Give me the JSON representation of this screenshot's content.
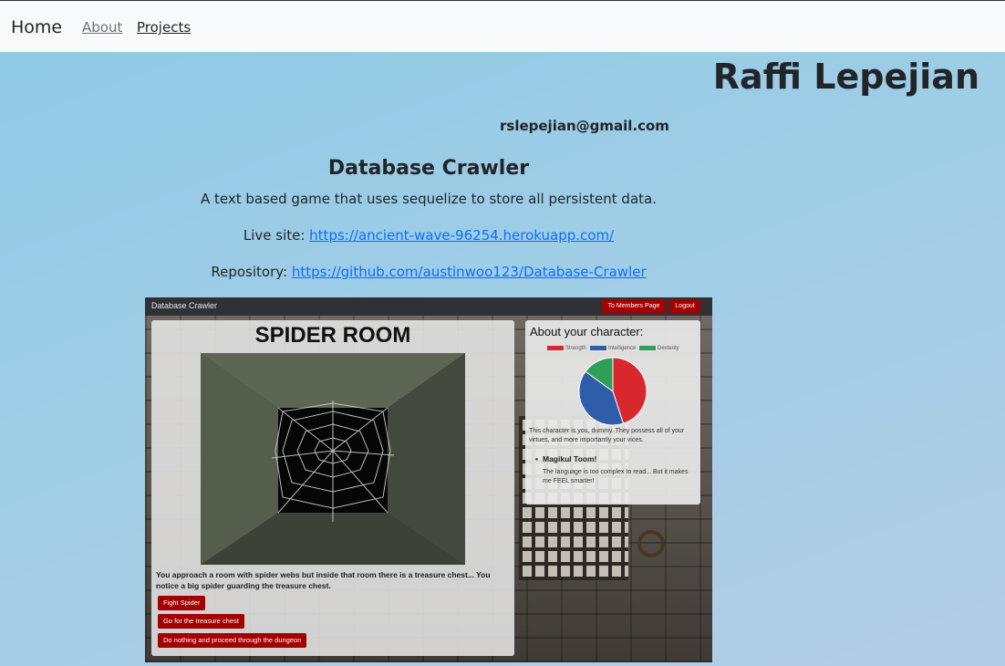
{
  "nav": {
    "brand": "Home",
    "links": [
      "About",
      "Projects"
    ]
  },
  "header": {
    "name": "Raffi Lepejian",
    "email": "rslepejian@gmail.com"
  },
  "project": {
    "title": "Database Crawler",
    "description": "A text based game that uses sequelize to store all persistent data.",
    "live_label": "Live site: ",
    "live_url": "https://ancient-wave-96254.herokuapp.com/",
    "repo_label": "Repository: ",
    "repo_url": "https://github.com/austinwoo123/Database-Crawler"
  },
  "screenshot": {
    "app_title": "Database Crawler",
    "members_button": "To Members Page",
    "logout_button": "Logout",
    "room_title": "SPIDER ROOM",
    "room_description": "You approach a room with spider webs but inside that room there is a treasure chest... You notice a big spider guarding the treasure chest.",
    "actions": [
      "Fight Spider",
      "Go for the treasure chest",
      "Do nothing and proceed through the dungeon"
    ],
    "character_title": "About your character:",
    "character_text": "This character is you, dummy. They possess all of your virtues, and more importantly your vices.",
    "item_name": "Magikul Toom!",
    "item_text": "The language is too complex to read... But it makes me FEEL smarter!",
    "chart_data": {
      "type": "pie",
      "categories": [
        "Strength",
        "Intelligence",
        "Dexterity"
      ],
      "values": [
        45,
        40,
        15
      ],
      "colors": [
        "#d9272e",
        "#2f5da9",
        "#2f9e57"
      ]
    }
  }
}
